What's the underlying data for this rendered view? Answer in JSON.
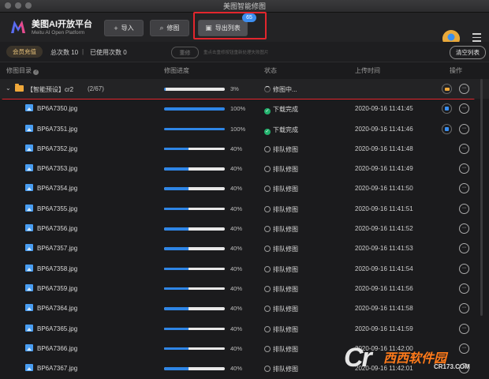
{
  "window": {
    "title": "美图智能修图"
  },
  "brand": {
    "name_cn": "美图AI开放平台",
    "name_en": "Meitu AI Open Platform"
  },
  "toolbar": {
    "import_label": "导入",
    "retouch_label": "修图",
    "export_label": "导出列表",
    "export_badge": "65"
  },
  "stats": {
    "vip_label": "会员充值",
    "total_label": "总次数 10",
    "separator": "|",
    "used_label": "已使用次数 0",
    "retry_label": "重修",
    "retry_hint": "重点击重修按钮重新处理失败图片",
    "clear_label": "清空列表"
  },
  "columns": {
    "dir": "修图目录",
    "progress": "修图进度",
    "status": "状态",
    "time": "上传时间",
    "actions": "操作"
  },
  "group": {
    "name": "【智能预设】cr2",
    "count": "(2/67)",
    "progress": 3,
    "pct": "3%",
    "status": "修图中..."
  },
  "rows": [
    {
      "name": "BP6A7350.jpg",
      "progress": 100,
      "pct": "100%",
      "status": "下载完成",
      "state": "done",
      "time": "2020-09-16 11:41:45"
    },
    {
      "name": "BP6A7351.jpg",
      "progress": 100,
      "pct": "100%",
      "status": "下载完成",
      "state": "done",
      "time": "2020-09-16 11:41:46"
    },
    {
      "name": "BP6A7352.jpg",
      "progress": 40,
      "pct": "40%",
      "status": "排队修图",
      "state": "wait",
      "time": "2020-09-16 11:41:48"
    },
    {
      "name": "BP6A7353.jpg",
      "progress": 40,
      "pct": "40%",
      "status": "排队修图",
      "state": "wait",
      "time": "2020-09-16 11:41:49"
    },
    {
      "name": "BP6A7354.jpg",
      "progress": 40,
      "pct": "40%",
      "status": "排队修图",
      "state": "wait",
      "time": "2020-09-16 11:41:50"
    },
    {
      "name": "BP6A7355.jpg",
      "progress": 40,
      "pct": "40%",
      "status": "排队修图",
      "state": "wait",
      "time": "2020-09-16 11:41:51"
    },
    {
      "name": "BP6A7356.jpg",
      "progress": 40,
      "pct": "40%",
      "status": "排队修图",
      "state": "wait",
      "time": "2020-09-16 11:41:52"
    },
    {
      "name": "BP6A7357.jpg",
      "progress": 40,
      "pct": "40%",
      "status": "排队修图",
      "state": "wait",
      "time": "2020-09-16 11:41:53"
    },
    {
      "name": "BP6A7358.jpg",
      "progress": 40,
      "pct": "40%",
      "status": "排队修图",
      "state": "wait",
      "time": "2020-09-16 11:41:54"
    },
    {
      "name": "BP6A7359.jpg",
      "progress": 40,
      "pct": "40%",
      "status": "排队修图",
      "state": "wait",
      "time": "2020-09-16 11:41:56"
    },
    {
      "name": "BP6A7364.jpg",
      "progress": 40,
      "pct": "40%",
      "status": "排队修图",
      "state": "wait",
      "time": "2020-09-16 11:41:58"
    },
    {
      "name": "BP6A7365.jpg",
      "progress": 40,
      "pct": "40%",
      "status": "排队修图",
      "state": "wait",
      "time": "2020-09-16 11:41:59"
    },
    {
      "name": "BP6A7366.jpg",
      "progress": 40,
      "pct": "40%",
      "status": "排队修图",
      "state": "wait",
      "time": "2020-09-16 11:42:00"
    },
    {
      "name": "BP6A7367.jpg",
      "progress": 40,
      "pct": "40%",
      "status": "排队修图",
      "state": "wait",
      "time": "2020-09-16 11:42:01"
    }
  ],
  "watermark": {
    "logo": "Cr",
    "text": "西西软件园",
    "sub": "CR173.COM"
  },
  "colors": {
    "accent": "#2f86e6",
    "highlight": "#e3262d",
    "folder": "#f0a83a",
    "done": "#22b26d"
  }
}
